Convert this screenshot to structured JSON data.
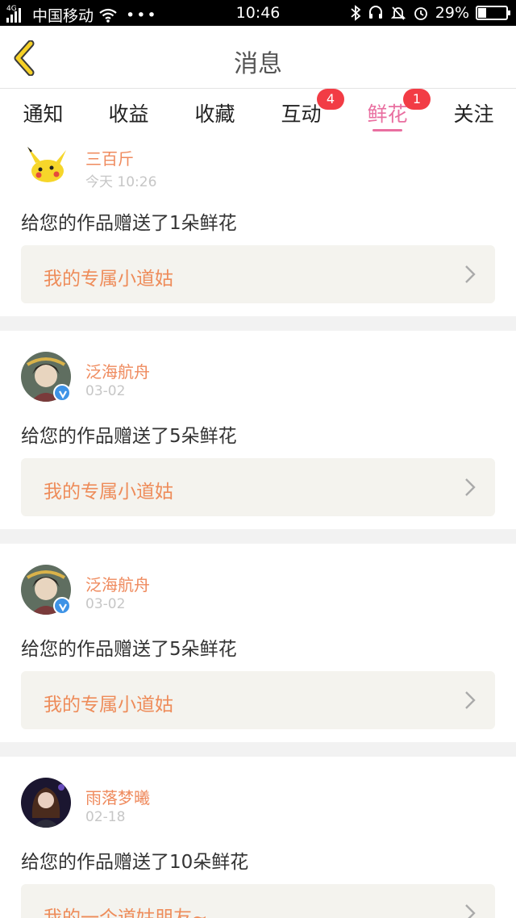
{
  "status_bar": {
    "signal_label": "4G",
    "carrier": "中国移动",
    "wifi_icon": "wifi-icon",
    "more": "•••",
    "time": "10:46",
    "battery": "29%",
    "battery_level": 0.29
  },
  "header": {
    "back_icon": "chevron-left-icon",
    "title": "消息"
  },
  "tabs": [
    {
      "label": "通知",
      "badge": ""
    },
    {
      "label": "收益",
      "badge": ""
    },
    {
      "label": "收藏",
      "badge": ""
    },
    {
      "label": "互动",
      "badge": "4"
    },
    {
      "label": "鲜花",
      "badge": "1",
      "active": true
    },
    {
      "label": "关注",
      "badge": ""
    }
  ],
  "messages": [
    {
      "user": "三百斤",
      "time": "今天 10:26",
      "text": "给您的作品赠送了1朵鲜花",
      "work_title": "我的专属小道姑",
      "verified": false
    },
    {
      "user": "泛海航舟",
      "time": "03-02",
      "text": "给您的作品赠送了5朵鲜花",
      "work_title": "我的专属小道姑",
      "verified": true
    },
    {
      "user": "泛海航舟",
      "time": "03-02",
      "text": "给您的作品赠送了5朵鲜花",
      "work_title": "我的专属小道姑",
      "verified": true
    },
    {
      "user": "雨落梦曦",
      "time": "02-18",
      "text": "给您的作品赠送了10朵鲜花",
      "work_title": "我的一个道姑朋友~",
      "verified": false
    }
  ],
  "colors": {
    "accent": "#e96fa0",
    "badge": "#f23c45",
    "username": "#ef8a5d",
    "link_bg": "#f4f3ee"
  }
}
